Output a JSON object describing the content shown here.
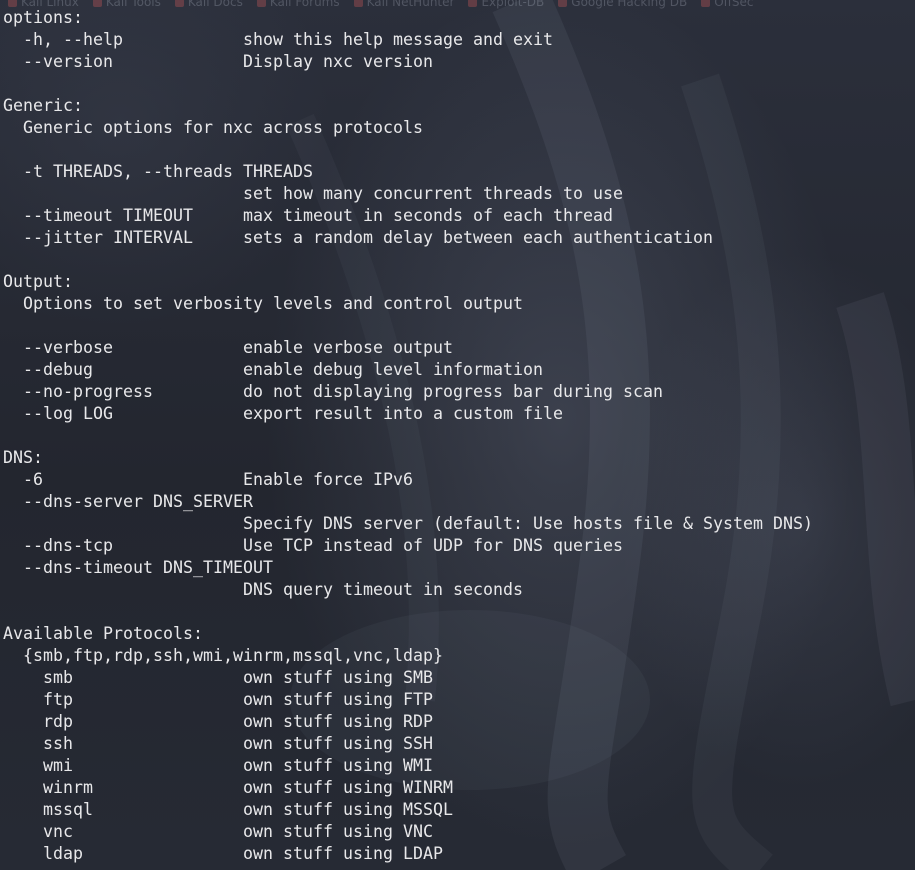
{
  "bookmarks": [
    "Kali Linux",
    "Kali Tools",
    "Kali Docs",
    "Kali Forums",
    "Kali NetHunter",
    "Exploit-DB",
    "Google Hacking DB",
    "OffSec"
  ],
  "lines": [
    {
      "level": 0,
      "text": "options:",
      "row": 0
    },
    {
      "level": 1,
      "opt": "-h, --help",
      "desc": "show this help message and exit",
      "row": 1
    },
    {
      "level": 1,
      "opt": "--version",
      "desc": "Display nxc version",
      "row": 2
    },
    {
      "level": 0,
      "text": "Generic:",
      "row": 4
    },
    {
      "level": 1,
      "text": "Generic options for nxc across protocols",
      "row": 5
    },
    {
      "level": 1,
      "text": "-t THREADS, --threads THREADS",
      "row": 7
    },
    {
      "level": 2,
      "desc": "set how many concurrent threads to use",
      "row": 8
    },
    {
      "level": 1,
      "opt": "--timeout TIMEOUT",
      "desc": "max timeout in seconds of each thread",
      "row": 9
    },
    {
      "level": 1,
      "opt": "--jitter INTERVAL",
      "desc": "sets a random delay between each authentication",
      "row": 10
    },
    {
      "level": 0,
      "text": "Output:",
      "row": 12
    },
    {
      "level": 1,
      "text": "Options to set verbosity levels and control output",
      "row": 13
    },
    {
      "level": 1,
      "opt": "--verbose",
      "desc": "enable verbose output",
      "row": 15
    },
    {
      "level": 1,
      "opt": "--debug",
      "desc": "enable debug level information",
      "row": 16
    },
    {
      "level": 1,
      "opt": "--no-progress",
      "desc": "do not displaying progress bar during scan",
      "row": 17
    },
    {
      "level": 1,
      "opt": "--log LOG",
      "desc": "export result into a custom file",
      "row": 18
    },
    {
      "level": 0,
      "text": "DNS:",
      "row": 20
    },
    {
      "level": 1,
      "opt": "-6",
      "desc": "Enable force IPv6",
      "row": 21
    },
    {
      "level": 1,
      "text": "--dns-server DNS_SERVER",
      "row": 22
    },
    {
      "level": 2,
      "desc": "Specify DNS server (default: Use hosts file & System DNS)",
      "row": 23
    },
    {
      "level": 1,
      "opt": "--dns-tcp",
      "desc": "Use TCP instead of UDP for DNS queries",
      "row": 24
    },
    {
      "level": 1,
      "text": "--dns-timeout DNS_TIMEOUT",
      "row": 25
    },
    {
      "level": 2,
      "desc": "DNS query timeout in seconds",
      "row": 26
    },
    {
      "level": 0,
      "text": "Available Protocols:",
      "row": 28
    },
    {
      "level": 1,
      "text": "{smb,ftp,rdp,ssh,wmi,winrm,mssql,vnc,ldap}",
      "row": 29
    },
    {
      "level": 3,
      "opt": "smb",
      "desc": "own stuff using SMB",
      "row": 30
    },
    {
      "level": 3,
      "opt": "ftp",
      "desc": "own stuff using FTP",
      "row": 31
    },
    {
      "level": 3,
      "opt": "rdp",
      "desc": "own stuff using RDP",
      "row": 32
    },
    {
      "level": 3,
      "opt": "ssh",
      "desc": "own stuff using SSH",
      "row": 33
    },
    {
      "level": 3,
      "opt": "wmi",
      "desc": "own stuff using WMI",
      "row": 34
    },
    {
      "level": 3,
      "opt": "winrm",
      "desc": "own stuff using WINRM",
      "row": 35
    },
    {
      "level": 3,
      "opt": "mssql",
      "desc": "own stuff using MSSQL",
      "row": 36
    },
    {
      "level": 3,
      "opt": "vnc",
      "desc": "own stuff using VNC",
      "row": 37
    },
    {
      "level": 3,
      "opt": "ldap",
      "desc": "own stuff using LDAP",
      "row": 38
    }
  ],
  "colors": {
    "text": "#e8e8ea",
    "background": "#262a36"
  }
}
